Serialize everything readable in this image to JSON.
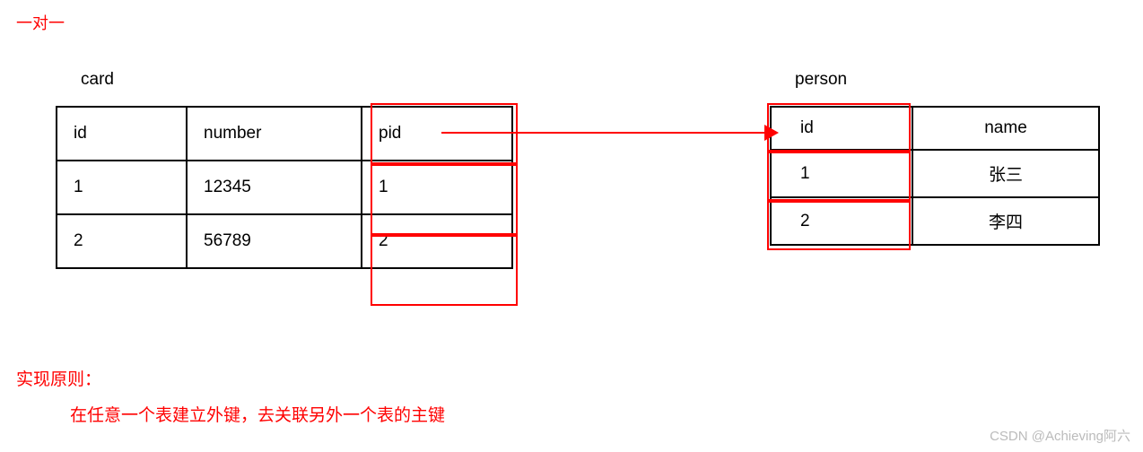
{
  "title": "一对一",
  "card": {
    "label": "card",
    "headers": [
      "id",
      "number",
      "pid"
    ],
    "rows": [
      [
        "1",
        "12345",
        "1"
      ],
      [
        "2",
        "56789",
        "2"
      ]
    ]
  },
  "person": {
    "label": "person",
    "headers": [
      "id",
      "name"
    ],
    "rows": [
      [
        "1",
        "张三"
      ],
      [
        "2",
        "李四"
      ]
    ]
  },
  "principle": {
    "label": "实现原则：",
    "text": "在任意一个表建立外键，去关联另外一个表的主键"
  },
  "watermark": "CSDN @Achieving阿六",
  "chart_data": {
    "type": "table",
    "description": "One-to-one relationship between card and person tables via foreign key pid -> id",
    "tables": [
      {
        "name": "card",
        "columns": [
          "id",
          "number",
          "pid"
        ],
        "rows": [
          [
            "1",
            "12345",
            "1"
          ],
          [
            "2",
            "56789",
            "2"
          ]
        ],
        "highlighted_column": "pid",
        "foreign_key": {
          "column": "pid",
          "references": "person.id"
        }
      },
      {
        "name": "person",
        "columns": [
          "id",
          "name"
        ],
        "rows": [
          [
            "1",
            "张三"
          ],
          [
            "2",
            "李四"
          ]
        ],
        "highlighted_column": "id",
        "primary_key": "id"
      }
    ],
    "relation": "card.pid → person.id"
  }
}
